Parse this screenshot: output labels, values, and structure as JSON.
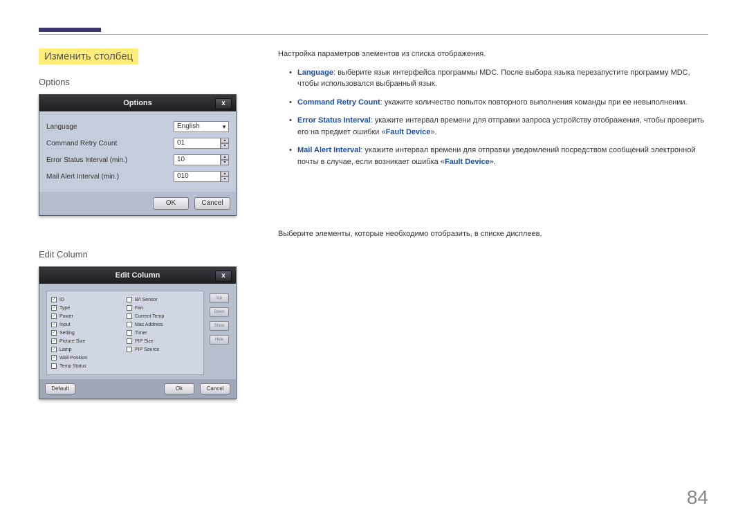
{
  "page": {
    "number": "84",
    "section_title": "Изменить столбец"
  },
  "options": {
    "heading": "Options",
    "dialog_title": "Options",
    "close_label": "x",
    "rows": {
      "language_label": "Language",
      "language_value": "English",
      "retry_label": "Command Retry Count",
      "retry_value": "01",
      "error_label": "Error Status Interval (min.)",
      "error_value": "10",
      "mail_label": "Mail Alert Interval (min.)",
      "mail_value": "010"
    },
    "ok": "OK",
    "cancel": "Cancel"
  },
  "edit_column": {
    "heading": "Edit Column",
    "dialog_title": "Edit Column",
    "close_label": "x",
    "col_left": [
      {
        "label": "ID",
        "checked": true
      },
      {
        "label": "Type",
        "checked": true
      },
      {
        "label": "Power",
        "checked": true
      },
      {
        "label": "Input",
        "checked": true
      },
      {
        "label": "Setting",
        "checked": true
      },
      {
        "label": "Picture Size",
        "checked": true
      },
      {
        "label": "Lamp",
        "checked": true
      },
      {
        "label": "Wall Position",
        "checked": true
      },
      {
        "label": "Temp Status",
        "checked": false
      }
    ],
    "col_right": [
      {
        "label": "B/I Sensor",
        "checked": false
      },
      {
        "label": "Fan",
        "checked": false
      },
      {
        "label": "Current Temp",
        "checked": false
      },
      {
        "label": "Mac Address",
        "checked": false
      },
      {
        "label": "Timer",
        "checked": false
      },
      {
        "label": "PIP Size",
        "checked": false
      },
      {
        "label": "PIP Source",
        "checked": false
      }
    ],
    "side_btns": [
      "Up",
      "Down",
      "Show",
      "Hide"
    ],
    "default_btn": "Default",
    "ok": "Ok",
    "cancel": "Cancel"
  },
  "right": {
    "options_intro": "Настройка параметров элементов из списка отображения.",
    "b1_kw": "Language",
    "b1_text": ": выберите язык интерфейса программы MDC. После выбора языка перезапустите программу MDC, чтобы использовался выбранный язык.",
    "b2_kw": "Command Retry Count",
    "b2_text": ": укажите количество попыток повторного выполнения команды при ее невыполнении.",
    "b3_kw": "Error Status Interval",
    "b3_text_a": ": укажите интервал времени для отправки запроса устройству отображения, чтобы проверить его на предмет ошибки «",
    "b3_fault": "Fault Device",
    "b3_text_b": "».",
    "b4_kw": "Mail Alert Interval",
    "b4_text_a": ": укажите интервал времени для отправки уведомлений посредством сообщений электронной почты в случае, если возникает ошибка «",
    "b4_fault": "Fault Device",
    "b4_text_b": "».",
    "editcol_desc": "Выберите элементы, которые необходимо отобразить, в списке дисплеев."
  }
}
